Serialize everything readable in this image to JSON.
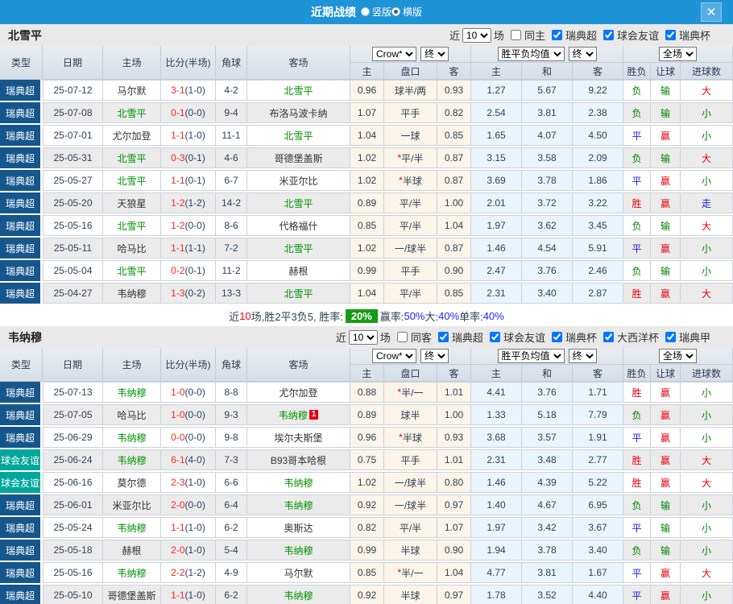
{
  "colors": {
    "titlebar_blue": "#1e93d6",
    "league_super_blue": "#15568c",
    "league_friendly_teal": "#00a79d",
    "focus_team_green": "#009100",
    "win_red": "#e60012",
    "draw_blue": "#2121de",
    "lose_green": "#008000",
    "rate_badge_green": "#149c14"
  },
  "titlebar": {
    "title": "近期战绩",
    "radios": [
      {
        "label": "竖版",
        "selected": false
      },
      {
        "label": "横版",
        "selected": true
      }
    ],
    "close_label": "✕"
  },
  "table_header": {
    "type": "类型",
    "date": "日期",
    "home": "主场",
    "score": "比分(半场)",
    "corner": "角球",
    "away": "客场",
    "crow_select": "Crow*",
    "end_select": "终",
    "avg_select": "胜平负均值",
    "end_select2": "终",
    "full_select": "全场",
    "sub": [
      "主",
      "盘口",
      "客",
      "主",
      "和",
      "客",
      "胜负",
      "让球",
      "进球数"
    ]
  },
  "sections": [
    {
      "team": "北雪平",
      "filter": {
        "near": "近",
        "count": "10",
        "games": "场",
        "same": {
          "label": "同主",
          "checked": false
        },
        "leagues": [
          {
            "label": "瑞典超",
            "checked": true
          },
          {
            "label": "球会友谊",
            "checked": true
          },
          {
            "label": "瑞典杯",
            "checked": true
          }
        ]
      },
      "rows": [
        {
          "league": "瑞典超",
          "league_type": "super",
          "date": "25-07-12",
          "home": "马尔默",
          "home_focus": false,
          "score": "3-1",
          "half": "(1-0)",
          "corner": "4-2",
          "away": "北雪平",
          "away_focus": true,
          "odds": [
            "0.96",
            "球半/两",
            "0.93"
          ],
          "avg": [
            "1.27",
            "5.67",
            "9.22"
          ],
          "results": [
            {
              "text": "负",
              "color": "green"
            },
            {
              "text": "输",
              "color": "green"
            },
            {
              "text": "大",
              "color": "red"
            }
          ]
        },
        {
          "league": "瑞典超",
          "league_type": "super",
          "date": "25-07-08",
          "home": "北雪平",
          "home_focus": true,
          "score": "0-1",
          "half": "(0-0)",
          "corner": "9-4",
          "away": "布洛马波卡纳",
          "away_focus": false,
          "odds": [
            "1.07",
            "平手",
            "0.82"
          ],
          "avg": [
            "2.54",
            "3.81",
            "2.38"
          ],
          "results": [
            {
              "text": "负",
              "color": "green"
            },
            {
              "text": "输",
              "color": "green"
            },
            {
              "text": "小",
              "color": "green"
            }
          ]
        },
        {
          "league": "瑞典超",
          "league_type": "super",
          "date": "25-07-01",
          "home": "尤尔加登",
          "home_focus": false,
          "score": "1-1",
          "half": "(1-0)",
          "corner": "11-1",
          "away": "北雪平",
          "away_focus": true,
          "odds": [
            "1.04",
            "一球",
            "0.85"
          ],
          "avg": [
            "1.65",
            "4.07",
            "4.50"
          ],
          "results": [
            {
              "text": "平",
              "color": "blue"
            },
            {
              "text": "赢",
              "color": "red"
            },
            {
              "text": "小",
              "color": "green"
            }
          ]
        },
        {
          "league": "瑞典超",
          "league_type": "super",
          "date": "25-05-31",
          "home": "北雪平",
          "home_focus": true,
          "score": "0-3",
          "half": "(0-1)",
          "corner": "4-6",
          "away": "哥德堡盖斯",
          "away_focus": false,
          "odds": [
            "1.02",
            "*平/半",
            "0.87"
          ],
          "avg": [
            "3.15",
            "3.58",
            "2.09"
          ],
          "results": [
            {
              "text": "负",
              "color": "green"
            },
            {
              "text": "输",
              "color": "green"
            },
            {
              "text": "大",
              "color": "red"
            }
          ]
        },
        {
          "league": "瑞典超",
          "league_type": "super",
          "date": "25-05-27",
          "home": "北雪平",
          "home_focus": true,
          "score": "1-1",
          "half": "(0-1)",
          "corner": "6-7",
          "away": "米亚尔比",
          "away_focus": false,
          "odds": [
            "1.02",
            "*半球",
            "0.87"
          ],
          "avg": [
            "3.69",
            "3.78",
            "1.86"
          ],
          "results": [
            {
              "text": "平",
              "color": "blue"
            },
            {
              "text": "赢",
              "color": "red"
            },
            {
              "text": "小",
              "color": "green"
            }
          ]
        },
        {
          "league": "瑞典超",
          "league_type": "super",
          "date": "25-05-20",
          "home": "天狼星",
          "home_focus": false,
          "score": "1-2",
          "half": "(1-2)",
          "corner": "14-2",
          "away": "北雪平",
          "away_focus": true,
          "odds": [
            "0.89",
            "平/半",
            "1.00"
          ],
          "avg": [
            "2.01",
            "3.72",
            "3.22"
          ],
          "results": [
            {
              "text": "胜",
              "color": "red"
            },
            {
              "text": "赢",
              "color": "red"
            },
            {
              "text": "走",
              "color": "blue"
            }
          ]
        },
        {
          "league": "瑞典超",
          "league_type": "super",
          "date": "25-05-16",
          "home": "北雪平",
          "home_focus": true,
          "score": "1-2",
          "half": "(0-0)",
          "corner": "8-6",
          "away": "代格福什",
          "away_focus": false,
          "odds": [
            "0.85",
            "平/半",
            "1.04"
          ],
          "avg": [
            "1.97",
            "3.62",
            "3.45"
          ],
          "results": [
            {
              "text": "负",
              "color": "green"
            },
            {
              "text": "输",
              "color": "green"
            },
            {
              "text": "大",
              "color": "red"
            }
          ]
        },
        {
          "league": "瑞典超",
          "league_type": "super",
          "date": "25-05-11",
          "home": "哈马比",
          "home_focus": false,
          "score": "1-1",
          "half": "(1-1)",
          "corner": "7-2",
          "away": "北雪平",
          "away_focus": true,
          "odds": [
            "1.02",
            "一/球半",
            "0.87"
          ],
          "avg": [
            "1.46",
            "4.54",
            "5.91"
          ],
          "results": [
            {
              "text": "平",
              "color": "blue"
            },
            {
              "text": "赢",
              "color": "red"
            },
            {
              "text": "小",
              "color": "green"
            }
          ]
        },
        {
          "league": "瑞典超",
          "league_type": "super",
          "date": "25-05-04",
          "home": "北雪平",
          "home_focus": true,
          "score": "0-2",
          "half": "(0-1)",
          "corner": "11-2",
          "away": "赫根",
          "away_focus": false,
          "odds": [
            "0.99",
            "平手",
            "0.90"
          ],
          "avg": [
            "2.47",
            "3.76",
            "2.46"
          ],
          "results": [
            {
              "text": "负",
              "color": "green"
            },
            {
              "text": "输",
              "color": "green"
            },
            {
              "text": "小",
              "color": "green"
            }
          ]
        },
        {
          "league": "瑞典超",
          "league_type": "super",
          "date": "25-04-27",
          "home": "韦纳穆",
          "home_focus": false,
          "score": "1-3",
          "half": "(0-2)",
          "corner": "13-3",
          "away": "北雪平",
          "away_focus": true,
          "odds": [
            "1.04",
            "平/半",
            "0.85"
          ],
          "avg": [
            "2.31",
            "3.40",
            "2.87"
          ],
          "results": [
            {
              "text": "胜",
              "color": "red"
            },
            {
              "text": "赢",
              "color": "red"
            },
            {
              "text": "大",
              "color": "red"
            }
          ]
        }
      ],
      "summary": {
        "parts": [
          {
            "text": "近",
            "style": "dark"
          },
          {
            "text": "10",
            "style": "red"
          },
          {
            "text": "场,胜2平3负5, 胜率:",
            "style": "dark"
          },
          {
            "text": "20%",
            "style": "badge"
          },
          {
            "text": " 赢率:",
            "style": "dark"
          },
          {
            "text": "50%",
            "style": "blue"
          },
          {
            "text": " 大:",
            "style": "dark"
          },
          {
            "text": "40%",
            "style": "blue"
          },
          {
            "text": " 单率:",
            "style": "dark"
          },
          {
            "text": "40%",
            "style": "blue"
          }
        ]
      }
    },
    {
      "team": "韦纳穆",
      "filter": {
        "near": "近",
        "count": "10",
        "games": "场",
        "same": {
          "label": "同客",
          "checked": false
        },
        "leagues": [
          {
            "label": "瑞典超",
            "checked": true
          },
          {
            "label": "球会友谊",
            "checked": true
          },
          {
            "label": "瑞典杯",
            "checked": true
          },
          {
            "label": "大西洋杯",
            "checked": true
          },
          {
            "label": "瑞典甲",
            "checked": true
          }
        ]
      },
      "rows": [
        {
          "league": "瑞典超",
          "league_type": "super",
          "date": "25-07-13",
          "home": "韦纳穆",
          "home_focus": true,
          "score": "1-0",
          "half": "(0-0)",
          "corner": "8-8",
          "away": "尤尔加登",
          "away_focus": false,
          "odds": [
            "0.88",
            "*半/一",
            "1.01"
          ],
          "avg": [
            "4.41",
            "3.76",
            "1.71"
          ],
          "results": [
            {
              "text": "胜",
              "color": "red"
            },
            {
              "text": "赢",
              "color": "red"
            },
            {
              "text": "小",
              "color": "green"
            }
          ]
        },
        {
          "league": "瑞典超",
          "league_type": "super",
          "date": "25-07-05",
          "home": "哈马比",
          "home_focus": false,
          "score": "1-0",
          "half": "(0-0)",
          "corner": "9-3",
          "away": "韦纳穆",
          "away_focus": true,
          "away_badge": "1",
          "odds": [
            "0.89",
            "球半",
            "1.00"
          ],
          "avg": [
            "1.33",
            "5.18",
            "7.79"
          ],
          "results": [
            {
              "text": "负",
              "color": "green"
            },
            {
              "text": "赢",
              "color": "red"
            },
            {
              "text": "小",
              "color": "green"
            }
          ]
        },
        {
          "league": "瑞典超",
          "league_type": "super",
          "date": "25-06-29",
          "home": "韦纳穆",
          "home_focus": true,
          "score": "0-0",
          "half": "(0-0)",
          "corner": "9-8",
          "away": "埃尔夫斯堡",
          "away_focus": false,
          "odds": [
            "0.96",
            "*半球",
            "0.93"
          ],
          "avg": [
            "3.68",
            "3.57",
            "1.91"
          ],
          "results": [
            {
              "text": "平",
              "color": "blue"
            },
            {
              "text": "赢",
              "color": "red"
            },
            {
              "text": "小",
              "color": "green"
            }
          ]
        },
        {
          "league": "球会友谊",
          "league_type": "friendly",
          "date": "25-06-24",
          "home": "韦纳穆",
          "home_focus": true,
          "score": "6-1",
          "half": "(4-0)",
          "corner": "7-3",
          "away": "B93哥本哈根",
          "away_focus": false,
          "odds": [
            "0.75",
            "平手",
            "1.01"
          ],
          "avg": [
            "2.31",
            "3.48",
            "2.77"
          ],
          "results": [
            {
              "text": "胜",
              "color": "red"
            },
            {
              "text": "赢",
              "color": "red"
            },
            {
              "text": "大",
              "color": "red"
            }
          ]
        },
        {
          "league": "球会友谊",
          "league_type": "friendly",
          "date": "25-06-16",
          "home": "莫尔德",
          "home_focus": false,
          "score": "2-3",
          "half": "(1-0)",
          "corner": "6-6",
          "away": "韦纳穆",
          "away_focus": true,
          "odds": [
            "1.02",
            "一/球半",
            "0.80"
          ],
          "avg": [
            "1.46",
            "4.39",
            "5.22"
          ],
          "results": [
            {
              "text": "胜",
              "color": "red"
            },
            {
              "text": "赢",
              "color": "red"
            },
            {
              "text": "大",
              "color": "red"
            }
          ]
        },
        {
          "league": "瑞典超",
          "league_type": "super",
          "date": "25-06-01",
          "home": "米亚尔比",
          "home_focus": false,
          "score": "2-0",
          "half": "(0-0)",
          "corner": "6-4",
          "away": "韦纳穆",
          "away_focus": true,
          "odds": [
            "0.92",
            "一/球半",
            "0.97"
          ],
          "avg": [
            "1.40",
            "4.67",
            "6.95"
          ],
          "results": [
            {
              "text": "负",
              "color": "green"
            },
            {
              "text": "输",
              "color": "green"
            },
            {
              "text": "小",
              "color": "green"
            }
          ]
        },
        {
          "league": "瑞典超",
          "league_type": "super",
          "date": "25-05-24",
          "home": "韦纳穆",
          "home_focus": true,
          "score": "1-1",
          "half": "(1-0)",
          "corner": "6-2",
          "away": "奥斯达",
          "away_focus": false,
          "odds": [
            "0.82",
            "平/半",
            "1.07"
          ],
          "avg": [
            "1.97",
            "3.42",
            "3.67"
          ],
          "results": [
            {
              "text": "平",
              "color": "blue"
            },
            {
              "text": "输",
              "color": "green"
            },
            {
              "text": "小",
              "color": "green"
            }
          ]
        },
        {
          "league": "瑞典超",
          "league_type": "super",
          "date": "25-05-18",
          "home": "赫根",
          "home_focus": false,
          "score": "2-0",
          "half": "(1-0)",
          "corner": "5-4",
          "away": "韦纳穆",
          "away_focus": true,
          "odds": [
            "0.99",
            "半球",
            "0.90"
          ],
          "avg": [
            "1.94",
            "3.78",
            "3.40"
          ],
          "results": [
            {
              "text": "负",
              "color": "green"
            },
            {
              "text": "输",
              "color": "green"
            },
            {
              "text": "小",
              "color": "green"
            }
          ]
        },
        {
          "league": "瑞典超",
          "league_type": "super",
          "date": "25-05-16",
          "home": "韦纳穆",
          "home_focus": true,
          "score": "2-2",
          "half": "(1-2)",
          "corner": "4-9",
          "away": "马尔默",
          "away_focus": false,
          "odds": [
            "0.85",
            "*半/一",
            "1.04"
          ],
          "avg": [
            "4.77",
            "3.81",
            "1.67"
          ],
          "results": [
            {
              "text": "平",
              "color": "blue"
            },
            {
              "text": "赢",
              "color": "red"
            },
            {
              "text": "大",
              "color": "red"
            }
          ]
        },
        {
          "league": "瑞典超",
          "league_type": "super",
          "date": "25-05-10",
          "home": "哥德堡盖斯",
          "home_focus": false,
          "score": "1-1",
          "half": "(1-0)",
          "corner": "6-2",
          "away": "韦纳穆",
          "away_focus": true,
          "odds": [
            "0.92",
            "半球",
            "0.97"
          ],
          "avg": [
            "1.78",
            "3.52",
            "4.40"
          ],
          "results": [
            {
              "text": "平",
              "color": "blue"
            },
            {
              "text": "赢",
              "color": "red"
            },
            {
              "text": "小",
              "color": "green"
            }
          ]
        }
      ],
      "summary": null
    }
  ]
}
